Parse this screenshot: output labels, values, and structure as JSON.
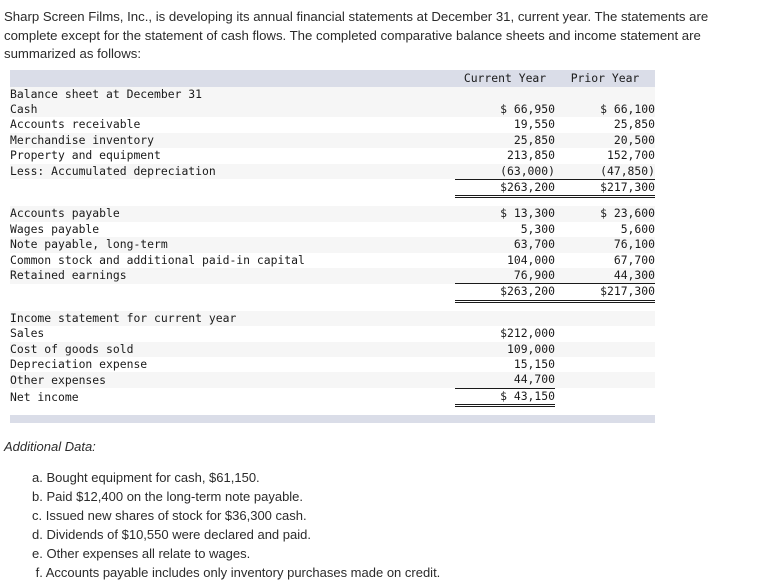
{
  "intro": {
    "text": "Sharp Screen Films, Inc., is developing its annual financial statements at December 31, current year. The statements are complete except for the statement of cash flows. The completed comparative balance sheets and income statement are summarized as follows:"
  },
  "table": {
    "columns": {
      "label": "",
      "current_year": "Current Year",
      "prior_year": "Prior Year"
    },
    "balance_sheet": {
      "title": "Balance sheet at December 31",
      "assets": [
        {
          "label": "Cash",
          "current": "$ 66,950",
          "prior": "$ 66,100"
        },
        {
          "label": "Accounts receivable",
          "current": "19,550",
          "prior": "25,850"
        },
        {
          "label": "Merchandise inventory",
          "current": "25,850",
          "prior": "20,500"
        },
        {
          "label": "Property and equipment",
          "current": "213,850",
          "prior": "152,700"
        },
        {
          "label": "Less: Accumulated depreciation",
          "current": "(63,000)",
          "prior": "(47,850)"
        }
      ],
      "assets_total": {
        "label": "",
        "current": "$263,200",
        "prior": "$217,300"
      },
      "liabilities_equity": [
        {
          "label": "Accounts payable",
          "current": "$ 13,300",
          "prior": "$ 23,600"
        },
        {
          "label": "Wages payable",
          "current": "5,300",
          "prior": "5,600"
        },
        {
          "label": "Note payable, long-term",
          "current": "63,700",
          "prior": "76,100"
        },
        {
          "label": "Common stock and additional paid-in capital",
          "current": "104,000",
          "prior": "67,700"
        },
        {
          "label": "Retained earnings",
          "current": "76,900",
          "prior": "44,300"
        }
      ],
      "liabilities_equity_total": {
        "label": "",
        "current": "$263,200",
        "prior": "$217,300"
      }
    },
    "income_statement": {
      "title": "Income statement for current year",
      "rows": [
        {
          "label": "Sales",
          "current": "$212,000"
        },
        {
          "label": "Cost of goods sold",
          "current": "109,000"
        },
        {
          "label": "Depreciation expense",
          "current": "15,150"
        },
        {
          "label": "Other expenses",
          "current": "44,700"
        }
      ],
      "net_income": {
        "label": "Net income",
        "current": "$ 43,150"
      }
    }
  },
  "additional_data": {
    "title": "Additional Data:",
    "items": [
      "a. Bought equipment for cash, $61,150.",
      "b. Paid $12,400 on the long-term note payable.",
      "c. Issued new shares of stock for $36,300 cash.",
      "d. Dividends of $10,550 were declared and paid.",
      "e. Other expenses all relate to wages.",
      " f. Accounts payable includes only inventory purchases made on credit."
    ]
  }
}
